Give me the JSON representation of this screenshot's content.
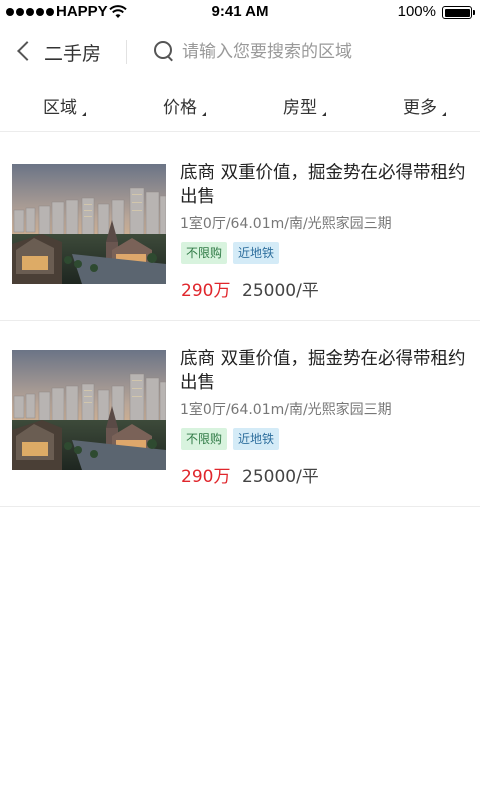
{
  "status_bar": {
    "carrier": "HAPPY",
    "time": "9:41 AM",
    "battery": "100%"
  },
  "header": {
    "back_icon": "chevron-left-icon",
    "title": "二手房",
    "search_icon": "search-icon",
    "search_placeholder": "请输入您要搜索的区域",
    "search_value": ""
  },
  "filters": [
    {
      "label": "区域",
      "icon": "caret-icon"
    },
    {
      "label": "价格",
      "icon": "caret-icon"
    },
    {
      "label": "房型",
      "icon": "caret-icon"
    },
    {
      "label": "更多",
      "icon": "caret-icon"
    }
  ],
  "listings": [
    {
      "title": "底商 双重价值，掘金势在必得带租约出售",
      "meta": "1室0厅/64.01m/南/光熙家园三期",
      "tags": [
        "不限购",
        "近地铁"
      ],
      "price": "290万",
      "unit_price": "25000/平"
    },
    {
      "title": "底商 双重价值，掘金势在必得带租约出售",
      "meta": "1室0厅/64.01m/南/光熙家园三期",
      "tags": [
        "不限购",
        "近地铁"
      ],
      "price": "290万",
      "unit_price": "25000/平"
    }
  ],
  "colors": {
    "price": "#e0262c",
    "tag_green_bg": "#d8f3de",
    "tag_blue_bg": "#d4ebf7"
  }
}
